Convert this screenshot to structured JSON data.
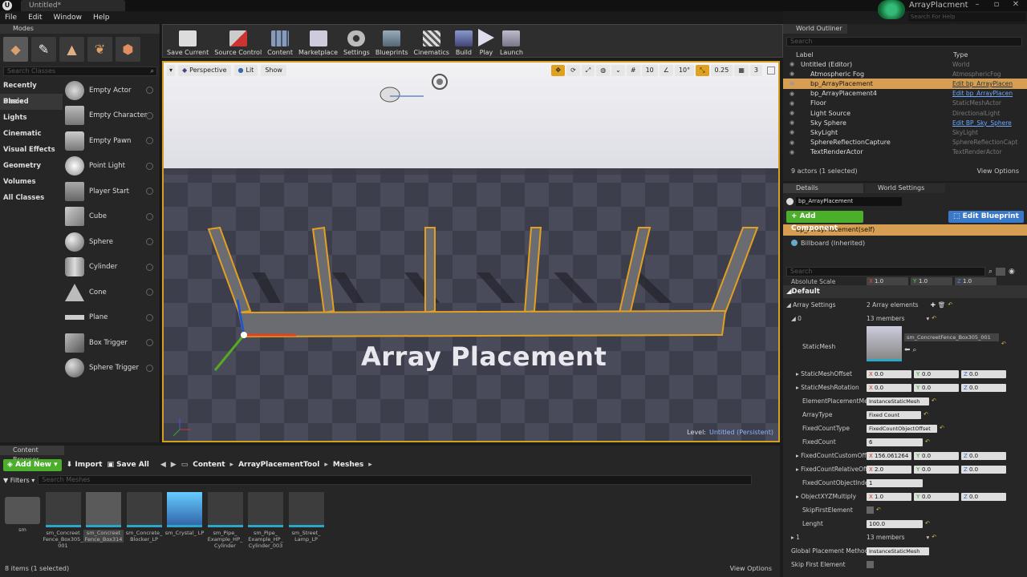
{
  "window": {
    "tab_title": "Untitled*",
    "project_name": "ArrayPlacment",
    "help_search_placeholder": "Search For Help"
  },
  "menu": [
    "File",
    "Edit",
    "Window",
    "Help"
  ],
  "modes": {
    "title": "Modes",
    "search_placeholder": "Search Classes",
    "categories": [
      "Recently Placed",
      "Basic",
      "Lights",
      "Cinematic",
      "Visual Effects",
      "Geometry",
      "Volumes",
      "All Classes"
    ],
    "items": [
      "Empty Actor",
      "Empty Character",
      "Empty Pawn",
      "Point Light",
      "Player Start",
      "Cube",
      "Sphere",
      "Cylinder",
      "Cone",
      "Plane",
      "Box Trigger",
      "Sphere Trigger"
    ]
  },
  "toolbar": [
    "Save Current",
    "Source Control",
    "Content",
    "Marketplace",
    "Settings",
    "Blueprints",
    "Cinematics",
    "Build",
    "Play",
    "Launch"
  ],
  "viewport": {
    "perspective": "Perspective",
    "lit": "Lit",
    "show": "Show",
    "grid_value": "10",
    "rot_value": "10°",
    "scale_value": "0.25",
    "cam_speed": "3",
    "text_actor": "Array Placement",
    "level_label": "Level:",
    "level_name": "Untitled (Persistent)"
  },
  "outliner": {
    "title": "World Outliner",
    "search_placeholder": "Search",
    "col_label": "Label",
    "col_type": "Type",
    "rows": [
      {
        "label": "Untitled (Editor)",
        "type": "World",
        "link": false,
        "sel": false,
        "indent": 0
      },
      {
        "label": "Atmospheric Fog",
        "type": "AtmosphericFog",
        "link": false,
        "sel": false,
        "indent": 1
      },
      {
        "label": "bp_ArrayPlacement",
        "type": "Edit bp_ArrayPlacen",
        "link": true,
        "sel": true,
        "indent": 1
      },
      {
        "label": "bp_ArrayPlacement4",
        "type": "Edit bp_ArrayPlacen",
        "link": true,
        "sel": false,
        "indent": 1
      },
      {
        "label": "Floor",
        "type": "StaticMeshActor",
        "link": false,
        "sel": false,
        "indent": 1
      },
      {
        "label": "Light Source",
        "type": "DirectionalLight",
        "link": false,
        "sel": false,
        "indent": 1
      },
      {
        "label": "Sky Sphere",
        "type": "Edit BP_Sky_Sphere",
        "link": true,
        "sel": false,
        "indent": 1
      },
      {
        "label": "SkyLight",
        "type": "SkyLight",
        "link": false,
        "sel": false,
        "indent": 1
      },
      {
        "label": "SphereReflectionCapture",
        "type": "SphereReflectionCapt",
        "link": false,
        "sel": false,
        "indent": 1
      },
      {
        "label": "TextRenderActor",
        "type": "TextRenderActor",
        "link": false,
        "sel": false,
        "indent": 1
      }
    ],
    "status": "9 actors (1 selected)",
    "view_options": "View Options"
  },
  "details": {
    "tab_details": "Details",
    "tab_world": "World Settings",
    "name_value": "bp_ArrayPlacement",
    "add_component": "+ Add Component",
    "edit_blueprint": "Edit Blueprint",
    "component_self": "bp_ArrayPlacement(self)",
    "component_billboard": "Billboard (Inherited)",
    "search_placeholder": "Search",
    "abs_scale_label": "Absolute Scale",
    "abs_scale": [
      "1.0",
      "1.0",
      "1.0"
    ],
    "section_default": "Default",
    "array_settings": "Array Settings",
    "array_elements": "2 Array elements",
    "elem0": "0",
    "members": "13 members",
    "static_mesh_label": "StaticMesh",
    "static_mesh_value": "sm_ConcreetFence_Box305_001",
    "rows": [
      {
        "label": "StaticMeshOffset",
        "x": "0.0",
        "y": "0.0",
        "z": "0.0"
      },
      {
        "label": "StaticMeshRotation",
        "x": "0.0",
        "y": "0.0",
        "z": "0.0"
      }
    ],
    "element_placement_label": "ElementPlacementMet",
    "element_placement_value": "InstanceStaticMesh",
    "array_type_label": "ArrayType",
    "array_type_value": "Fixed Count",
    "fixed_count_type_label": "FixedCountType",
    "fixed_count_type_value": "FixedCountObjectOffset",
    "fixed_count_label": "FixedCount",
    "fixed_count_value": "6",
    "custom_offs_label": "FixedCountCustomOffs",
    "custom_offs": [
      "156.061264",
      "0.0",
      "0.0"
    ],
    "relative_off_label": "FixedCountRelativeOff",
    "relative_off": [
      "2.0",
      "0.0",
      "0.0"
    ],
    "object_index_label": "FixedCountObjectIndex",
    "object_index_value": "1",
    "xyz_multiply_label": "ObjectXYZMultiply",
    "xyz_multiply": [
      "1.0",
      "0.0",
      "0.0"
    ],
    "skip_first_label": "SkipFirstElement",
    "length_label": "Lenght",
    "length_value": "100.0",
    "elem1": "1",
    "members1": "13 members",
    "global_placement_label": "Global Placement Method",
    "global_placement_value": "InstanceStaticMesh",
    "skip_first_global_label": "Skip First Element"
  },
  "content_browser": {
    "title": "Content Browser",
    "add_new": "Add New",
    "import": "Import",
    "save_all": "Save All",
    "path": [
      "Content",
      "ArrayPlacementTool",
      "Meshes"
    ],
    "filters": "Filters",
    "search_placeholder": "Search Meshes",
    "tiles": [
      "sm",
      "sm_Concreet Fence_Box305_ 001",
      "sm_Concreet Fence_Box314",
      "sm_Concrete_ Blocker_LP",
      "sm_Crystal_ LP",
      "sm_Pipe_ Example_HP_ Cylinder",
      "sm_Pipe_ Example_HP_ Cylinder_003",
      "sm_Street_ Lamp_LP"
    ],
    "status": "8 items (1 selected)",
    "view_options": "View Options"
  },
  "colors": {
    "selection": "#d69e52",
    "add_green": "#4caf2c",
    "edit_blue": "#3a78c8",
    "viewport_border": "#d5a020"
  }
}
